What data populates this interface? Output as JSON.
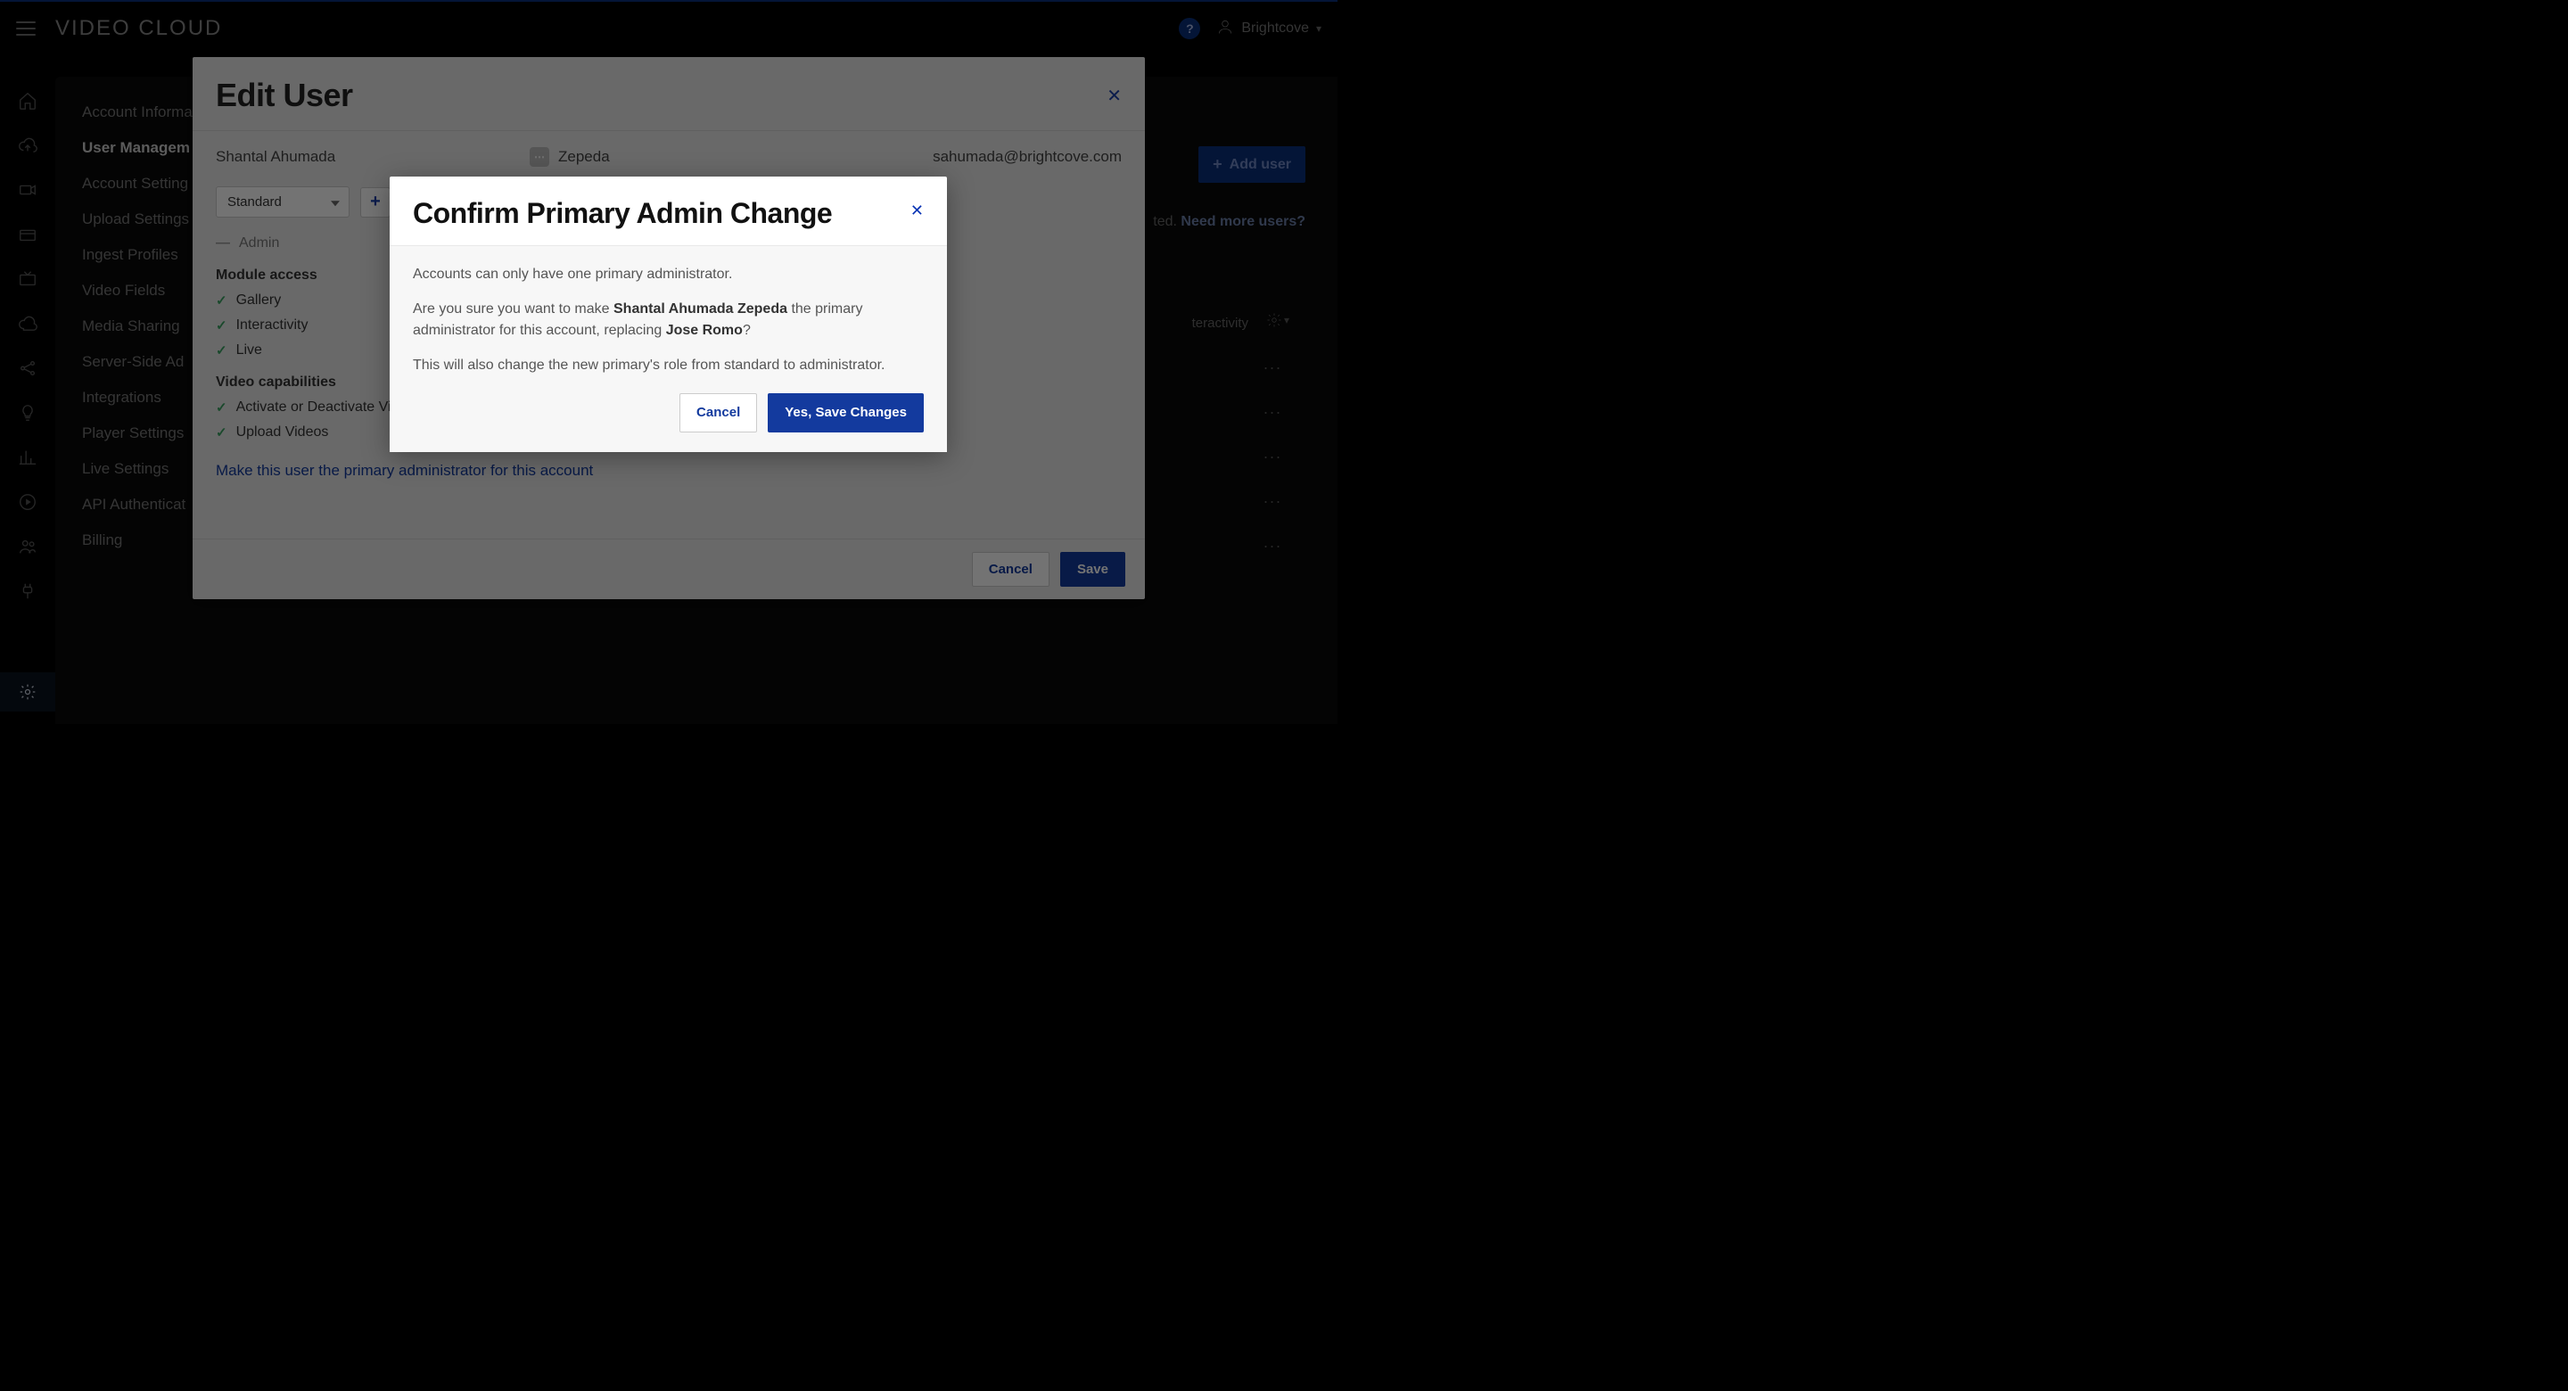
{
  "header": {
    "brand": "VIDEO CLOUD",
    "help_label": "?",
    "account_label": "Brightcove"
  },
  "sidebar_settings": [
    "Account Informa",
    "User Managem",
    "Account Setting",
    "Upload Settings",
    "Ingest Profiles",
    "Video Fields",
    "Media Sharing",
    "Server-Side Ad",
    "Integrations",
    "Player Settings",
    "Live Settings",
    "API Authenticat",
    "Billing"
  ],
  "main": {
    "add_user_label": "Add user",
    "need_more_prefix": "ted. ",
    "need_more_link": "Need more users?",
    "col_interactivity": "teractivity",
    "row_kebab": "..."
  },
  "edit_user": {
    "title": "Edit User",
    "first_name": "Shantal Ahumada",
    "last_name": "Zepeda",
    "email": "sahumada@brightcove.com",
    "role_value": "Standard",
    "admin_collapse_label": "Admin",
    "module_label": "Module access",
    "modules": [
      "Gallery",
      "Interactivity",
      "Live"
    ],
    "capabilities_label": "Video capabilities",
    "capabilities": [
      "Activate or Deactivate Vi",
      "Upload Videos"
    ],
    "primary_link": "Make this user the primary administrator for this account",
    "cancel_label": "Cancel",
    "save_label": "Save"
  },
  "confirm": {
    "title": "Confirm Primary Admin Change",
    "line1": "Accounts can only have one primary administrator.",
    "line2_a": "Are you sure you want to make ",
    "line2_name": "Shantal Ahumada Zepeda",
    "line2_b": " the primary administrator for this account, replacing ",
    "line2_replacing": "Jose Romo",
    "line2_c": "?",
    "line3": "This will also change the new primary's role from standard to administrator.",
    "cancel_label": "Cancel",
    "confirm_label": "Yes, Save Changes"
  }
}
